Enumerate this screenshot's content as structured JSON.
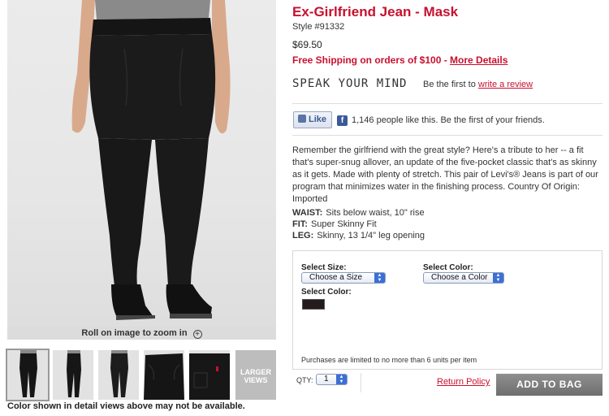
{
  "product": {
    "title": "Ex-Girlfriend Jean - Mask",
    "style": "Style #91332",
    "price": "$69.50",
    "shipping_text": "Free Shipping on orders of $100 - ",
    "shipping_link": "More Details",
    "tagline": "SPEAK YOUR MIND",
    "review_prefix": "Be the first to ",
    "review_link": "write a review"
  },
  "social": {
    "like_label": "Like",
    "fb_icon_glyph": "f",
    "like_text": "1,146 people like this. Be the first of your friends."
  },
  "description": "Remember the girlfriend with the great style? Here's a tribute to her -- a fit that's super-snug allover, an update of the five-pocket classic that's as skinny as it gets. Made with plenty of stretch. This pair of Levi's® Jeans is part of our program that minimizes water in the finishing process. Country Of Origin: Imported",
  "specs": [
    {
      "label": "WAIST:",
      "value": "Sits below waist, 10\" rise"
    },
    {
      "label": "FIT:",
      "value": "Super Skinny Fit"
    },
    {
      "label": "LEG:",
      "value": "Skinny, 13 1/4\" leg opening"
    }
  ],
  "options": {
    "size_label": "Select Size:",
    "size_value": "Choose a Size",
    "color_label": "Select Color:",
    "color_value": "Choose a Color",
    "swatch_label": "Select Color:",
    "swatch_color": "#241c1c",
    "limit_note": "Purchases are limited to no more than 6 units per item"
  },
  "purchase": {
    "qty_label": "QTY:",
    "qty_value": "1",
    "return_policy": "Return Policy",
    "add_to_bag": "ADD TO BAG"
  },
  "gallery": {
    "zoom_text": "Roll on image to zoom in",
    "zoom_icon_glyph": "+",
    "larger_views": "LARGER VIEWS",
    "color_note": "Color shown in detail views above may not be available."
  },
  "colors": {
    "brand_red": "#c8102e",
    "facebook_blue": "#3b5998",
    "button_gray": "#7f7f7f"
  }
}
